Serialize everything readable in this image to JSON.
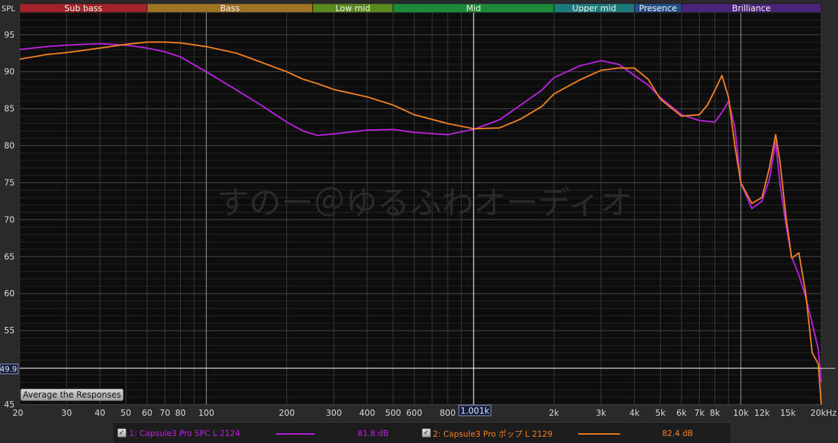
{
  "app": {
    "y_axis_title": "SPL",
    "x_unit": "Hz"
  },
  "bands": [
    {
      "name": "Sub bass",
      "color": "#a3232b"
    },
    {
      "name": "Bass",
      "color": "#9e7424"
    },
    {
      "name": "Low mid",
      "color": "#5a8a1e"
    },
    {
      "name": "Mid",
      "color": "#1c8a38"
    },
    {
      "name": "Upper mid",
      "color": "#1f7b7b"
    },
    {
      "name": "Presence",
      "color": "#244f87"
    },
    {
      "name": "Brilliance",
      "color": "#4a2478"
    }
  ],
  "cursor": {
    "freq_label": "1.001k",
    "level_label": "49.9"
  },
  "watermark": "すのー＠ゆるふわオーディオ",
  "buttons": {
    "average": "Average the Responses"
  },
  "legend": [
    {
      "index_label": "1: Capsule3 Pro SPC L 2124",
      "value": "81.8 dB",
      "color": "#bb22dd",
      "checked": true
    },
    {
      "index_label": "2: Capsule3 Pro ポップ L 2129",
      "value": "82.4 dB",
      "color": "#f08020",
      "checked": true
    }
  ],
  "chart_data": {
    "type": "line",
    "title": "",
    "xlabel": "",
    "ylabel": "SPL",
    "x_scale": "log",
    "xlim": [
      20,
      20000
    ],
    "ylim": [
      45,
      98
    ],
    "grid": true,
    "x_tick_labels": [
      {
        "v": 20,
        "t": "20"
      },
      {
        "v": 30,
        "t": "30"
      },
      {
        "v": 40,
        "t": "40"
      },
      {
        "v": 50,
        "t": "50"
      },
      {
        "v": 60,
        "t": "60"
      },
      {
        "v": 70,
        "t": "70"
      },
      {
        "v": 80,
        "t": "80"
      },
      {
        "v": 100,
        "t": "100"
      },
      {
        "v": 200,
        "t": "200"
      },
      {
        "v": 300,
        "t": "300"
      },
      {
        "v": 400,
        "t": "400"
      },
      {
        "v": 500,
        "t": "500"
      },
      {
        "v": 600,
        "t": "600"
      },
      {
        "v": 800,
        "t": "800"
      },
      {
        "v": 2000,
        "t": "2k"
      },
      {
        "v": 3000,
        "t": "3k"
      },
      {
        "v": 4000,
        "t": "4k"
      },
      {
        "v": 5000,
        "t": "5k"
      },
      {
        "v": 6000,
        "t": "6k"
      },
      {
        "v": 7000,
        "t": "7k"
      },
      {
        "v": 8000,
        "t": "8k"
      },
      {
        "v": 10000,
        "t": "10k"
      },
      {
        "v": 12000,
        "t": "12k"
      },
      {
        "v": 15000,
        "t": "15k"
      },
      {
        "v": 20000,
        "t": "20kHz"
      }
    ],
    "y_tick_labels": [
      {
        "v": 95,
        "t": "95"
      },
      {
        "v": 90,
        "t": "90"
      },
      {
        "v": 85,
        "t": "85"
      },
      {
        "v": 80,
        "t": "80"
      },
      {
        "v": 75,
        "t": "75"
      },
      {
        "v": 70,
        "t": "70"
      },
      {
        "v": 65,
        "t": "65"
      },
      {
        "v": 60,
        "t": "60"
      },
      {
        "v": 55,
        "t": "55"
      },
      {
        "v": 50,
        "t": "50"
      },
      {
        "v": 45,
        "t": "45"
      }
    ],
    "bands": [
      {
        "name": "Sub bass",
        "from": 20,
        "to": 60
      },
      {
        "name": "Bass",
        "from": 60,
        "to": 250
      },
      {
        "name": "Low mid",
        "from": 250,
        "to": 500
      },
      {
        "name": "Mid",
        "from": 500,
        "to": 2000
      },
      {
        "name": "Upper mid",
        "from": 2000,
        "to": 4000
      },
      {
        "name": "Presence",
        "from": 4000,
        "to": 6000
      },
      {
        "name": "Brilliance",
        "from": 6000,
        "to": 20000
      }
    ],
    "cursor": {
      "x": 1001,
      "y": 49.9
    },
    "series": [
      {
        "name": "1: Capsule3 Pro SPC L 2124",
        "color": "#bb22dd",
        "points": [
          [
            20,
            93.0
          ],
          [
            25,
            93.4
          ],
          [
            30,
            93.6
          ],
          [
            40,
            93.8
          ],
          [
            50,
            93.6
          ],
          [
            60,
            93.2
          ],
          [
            70,
            92.7
          ],
          [
            80,
            92.0
          ],
          [
            100,
            90.0
          ],
          [
            130,
            87.5
          ],
          [
            160,
            85.5
          ],
          [
            200,
            83.2
          ],
          [
            230,
            82.0
          ],
          [
            260,
            81.4
          ],
          [
            300,
            81.6
          ],
          [
            400,
            82.1
          ],
          [
            500,
            82.2
          ],
          [
            600,
            81.8
          ],
          [
            800,
            81.5
          ],
          [
            1000,
            82.2
          ],
          [
            1250,
            83.5
          ],
          [
            1500,
            85.5
          ],
          [
            1800,
            87.5
          ],
          [
            2000,
            89.2
          ],
          [
            2500,
            90.8
          ],
          [
            3000,
            91.5
          ],
          [
            3500,
            91.0
          ],
          [
            4000,
            89.5
          ],
          [
            4500,
            88.2
          ],
          [
            5000,
            86.5
          ],
          [
            6000,
            84.2
          ],
          [
            7000,
            83.4
          ],
          [
            7500,
            83.3
          ],
          [
            8000,
            83.2
          ],
          [
            8500,
            84.5
          ],
          [
            9000,
            86.0
          ],
          [
            9500,
            82.5
          ],
          [
            10000,
            75.0
          ],
          [
            11000,
            71.5
          ],
          [
            12000,
            72.5
          ],
          [
            12800,
            75.5
          ],
          [
            13500,
            80.5
          ],
          [
            14000,
            75.0
          ],
          [
            14800,
            69.0
          ],
          [
            15500,
            65.0
          ],
          [
            16500,
            62.5
          ],
          [
            17500,
            59.5
          ],
          [
            18500,
            56.0
          ],
          [
            19500,
            52.5
          ],
          [
            20000,
            48.0
          ]
        ]
      },
      {
        "name": "2: Capsule3 Pro ポップ L 2129",
        "color": "#f08020",
        "points": [
          [
            20,
            91.7
          ],
          [
            25,
            92.3
          ],
          [
            30,
            92.6
          ],
          [
            40,
            93.2
          ],
          [
            50,
            93.7
          ],
          [
            60,
            94.0
          ],
          [
            70,
            94.0
          ],
          [
            80,
            93.9
          ],
          [
            100,
            93.4
          ],
          [
            130,
            92.5
          ],
          [
            160,
            91.3
          ],
          [
            200,
            90.0
          ],
          [
            230,
            89.0
          ],
          [
            260,
            88.4
          ],
          [
            300,
            87.6
          ],
          [
            400,
            86.6
          ],
          [
            500,
            85.5
          ],
          [
            600,
            84.2
          ],
          [
            800,
            83.0
          ],
          [
            1000,
            82.3
          ],
          [
            1250,
            82.4
          ],
          [
            1500,
            83.6
          ],
          [
            1800,
            85.3
          ],
          [
            2000,
            87.0
          ],
          [
            2500,
            88.9
          ],
          [
            3000,
            90.2
          ],
          [
            3500,
            90.5
          ],
          [
            4000,
            90.5
          ],
          [
            4500,
            89.0
          ],
          [
            5000,
            86.3
          ],
          [
            6000,
            84.0
          ],
          [
            7000,
            84.2
          ],
          [
            7500,
            85.5
          ],
          [
            8000,
            87.5
          ],
          [
            8500,
            89.5
          ],
          [
            9000,
            86.5
          ],
          [
            9500,
            80.0
          ],
          [
            10000,
            75.0
          ],
          [
            11000,
            72.2
          ],
          [
            12000,
            73.0
          ],
          [
            12800,
            77.0
          ],
          [
            13500,
            81.5
          ],
          [
            14000,
            78.0
          ],
          [
            14800,
            70.0
          ],
          [
            15500,
            64.8
          ],
          [
            16500,
            65.5
          ],
          [
            17500,
            60.0
          ],
          [
            18500,
            52.0
          ],
          [
            19500,
            50.5
          ],
          [
            20000,
            45.0
          ]
        ]
      }
    ]
  }
}
